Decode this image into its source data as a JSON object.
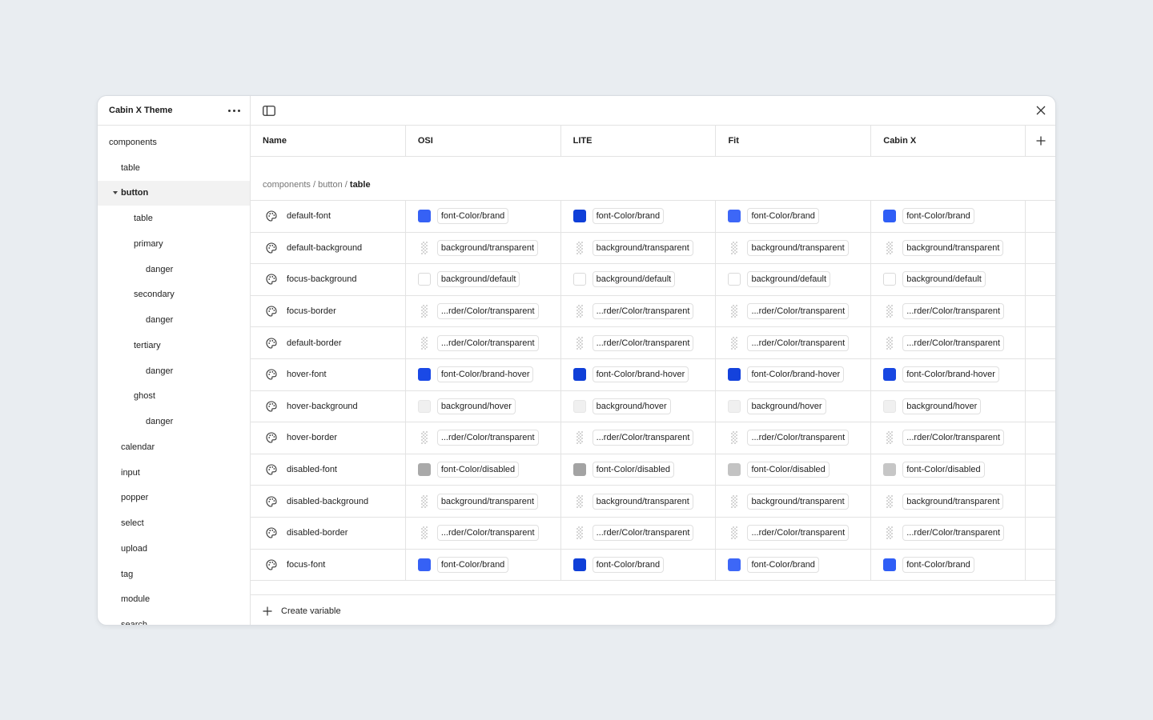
{
  "sidebar": {
    "title": "Cabin X Theme",
    "items": [
      {
        "label": "components",
        "level": 0
      },
      {
        "label": "table",
        "level": 1
      },
      {
        "label": "button",
        "level": 1,
        "active": true,
        "expanded": true
      },
      {
        "label": "table",
        "level": 2
      },
      {
        "label": "primary",
        "level": 2
      },
      {
        "label": "danger",
        "level": 3
      },
      {
        "label": "secondary",
        "level": 2
      },
      {
        "label": "danger",
        "level": 3
      },
      {
        "label": "tertiary",
        "level": 2
      },
      {
        "label": "danger",
        "level": 3
      },
      {
        "label": "ghost",
        "level": 2
      },
      {
        "label": "danger",
        "level": 3
      },
      {
        "label": "calendar",
        "level": 1
      },
      {
        "label": "input",
        "level": 1
      },
      {
        "label": "popper",
        "level": 1
      },
      {
        "label": "select",
        "level": 1
      },
      {
        "label": "upload",
        "level": 1
      },
      {
        "label": "tag",
        "level": 1
      },
      {
        "label": "module",
        "level": 1
      },
      {
        "label": "search",
        "level": 1
      }
    ]
  },
  "columns": {
    "name": "Name",
    "modes": [
      "OSI",
      "LITE",
      "Fit",
      "Cabin X"
    ]
  },
  "breadcrumb": {
    "parts": [
      "components",
      "button"
    ],
    "current": "table",
    "separator": "/"
  },
  "colors": {
    "brand": [
      "#3661f5",
      "#0f3fd8",
      "#3d67f7",
      "#2f5ef6"
    ],
    "brand_hover": [
      "#1a49e6",
      "#0f3fd8",
      "#1442dc",
      "#1847e2"
    ],
    "hover_bg": "#f0f0f0",
    "disabled": [
      "#a9a9a9",
      "#a3a3a3",
      "#c3c3c3",
      "#c6c6c6"
    ]
  },
  "rows": [
    {
      "name": "default-font",
      "kind": "brand",
      "values": [
        "font-Color/brand",
        "font-Color/brand",
        "font-Color/brand",
        "font-Color/brand"
      ]
    },
    {
      "name": "default-background",
      "kind": "transparent",
      "values": [
        "background/transparent",
        "background/transparent",
        "background/transparent",
        "background/transparent"
      ]
    },
    {
      "name": "focus-background",
      "kind": "white",
      "values": [
        "background/default",
        "background/default",
        "background/default",
        "background/default"
      ]
    },
    {
      "name": "focus-border",
      "kind": "transparent",
      "values": [
        "...rder/Color/transparent",
        "...rder/Color/transparent",
        "...rder/Color/transparent",
        "...rder/Color/transparent"
      ]
    },
    {
      "name": "default-border",
      "kind": "transparent",
      "values": [
        "...rder/Color/transparent",
        "...rder/Color/transparent",
        "...rder/Color/transparent",
        "...rder/Color/transparent"
      ]
    },
    {
      "name": "hover-font",
      "kind": "brand_hover",
      "values": [
        "font-Color/brand-hover",
        "font-Color/brand-hover",
        "font-Color/brand-hover",
        "font-Color/brand-hover"
      ]
    },
    {
      "name": "hover-background",
      "kind": "hover_bg",
      "values": [
        "background/hover",
        "background/hover",
        "background/hover",
        "background/hover"
      ]
    },
    {
      "name": "hover-border",
      "kind": "transparent",
      "values": [
        "...rder/Color/transparent",
        "...rder/Color/transparent",
        "...rder/Color/transparent",
        "...rder/Color/transparent"
      ]
    },
    {
      "name": "disabled-font",
      "kind": "disabled",
      "values": [
        "font-Color/disabled",
        "font-Color/disabled",
        "font-Color/disabled",
        "font-Color/disabled"
      ]
    },
    {
      "name": "disabled-background",
      "kind": "transparent",
      "values": [
        "background/transparent",
        "background/transparent",
        "background/transparent",
        "background/transparent"
      ]
    },
    {
      "name": "disabled-border",
      "kind": "transparent",
      "values": [
        "...rder/Color/transparent",
        "...rder/Color/transparent",
        "...rder/Color/transparent",
        "...rder/Color/transparent"
      ]
    },
    {
      "name": "focus-font",
      "kind": "brand",
      "values": [
        "font-Color/brand",
        "font-Color/brand",
        "font-Color/brand",
        "font-Color/brand"
      ]
    }
  ],
  "footer": {
    "create_label": "Create variable"
  },
  "icons": {
    "more": "more-horizontal-icon",
    "sidebar_toggle": "sidebar-toggle-icon",
    "close": "close-icon",
    "add": "plus-icon",
    "variable": "palette-icon",
    "expand": "caret-down-icon"
  }
}
